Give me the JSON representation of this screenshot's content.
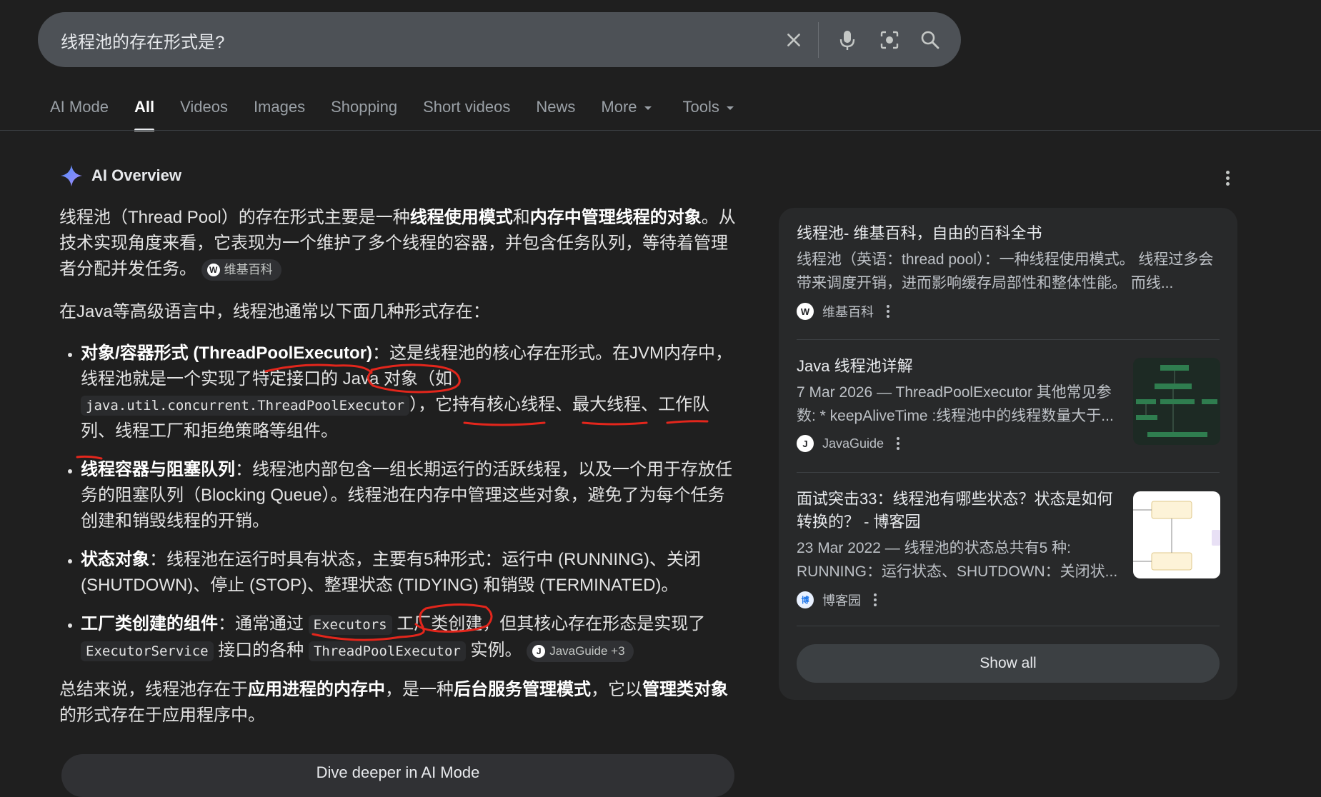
{
  "search": {
    "query": "线程池的存在形式是?"
  },
  "tabs": [
    {
      "label": "AI Mode"
    },
    {
      "label": "All"
    },
    {
      "label": "Videos"
    },
    {
      "label": "Images"
    },
    {
      "label": "Shopping"
    },
    {
      "label": "Short videos"
    },
    {
      "label": "News"
    },
    {
      "label": "More"
    },
    {
      "label": "Tools"
    }
  ],
  "ai_overview": {
    "title": "AI Overview",
    "p1": {
      "t1": "线程池（Thread Pool）的存在形式主要是一种",
      "b1": "线程使用模式",
      "t2": "和",
      "b2": "内存中管理线程的对象",
      "t3": "。从技术实现角度来看，它表现为一个维护了多个线程的容器，并包含任务队列，等待着管理者分配并发任务。",
      "chip": "维基百科"
    },
    "p2": "在Java等高级语言中，线程池通常以下面几种形式存在：",
    "bullets": [
      {
        "bold": "对象/容器形式 (ThreadPoolExecutor)",
        "t1": "：这是线程池的核心存在形式。在JVM内存中，线程池就是一个实现了特定接口的 Java 对象（如 ",
        "code": "java.util.concurrent.ThreadPoolExecutor",
        "t2": "），它持有核心线程、最大线程、工作队列、线程工厂和拒绝策略等组件。"
      },
      {
        "bold": "线程容器与阻塞队列",
        "t1": "：线程池内部包含一组长期运行的活跃线程，以及一个用于存放任务的阻塞队列（Blocking Queue）。线程池在内存中管理这些对象，避免了为每个任务创建和销毁线程的开销。"
      },
      {
        "bold": "状态对象",
        "t1": "：线程池在运行时具有状态，主要有5种形式：运行中 (RUNNING)、关闭 (SHUTDOWN)、停止 (STOP)、整理状态 (TIDYING) 和销毁 (TERMINATED)。"
      },
      {
        "bold": "工厂类创建的组件",
        "t1": "：通常通过 ",
        "code1": "Executors",
        "t2": " 工厂类创建，但其核心存在形态是实现了 ",
        "code2": "ExecutorService",
        "t3": " 接口的各种 ",
        "code3": "ThreadPoolExecutor",
        "t4": " 实例。",
        "chip": "JavaGuide +3"
      }
    ],
    "summary": {
      "t1": "总结来说，线程池存在于",
      "b1": "应用进程的内存中",
      "t2": "，是一种",
      "b2": "后台服务管理模式",
      "t3": "，它以",
      "b3": "管理类对象",
      "t4": "的形式存在于应用程序中。"
    },
    "dive_button": "Dive deeper in AI Mode"
  },
  "sources": [
    {
      "title": "线程池- 维基百科，自由的百科全书",
      "snippet": "线程池（英语：thread pool）：一种线程使用模式。 线程过多会带来调度开销，进而影响缓存局部性和整体性能。 而线...",
      "site": "维基百科",
      "favicon": "W"
    },
    {
      "title": "Java 线程池详解",
      "snippet": "7 Mar 2026 — ThreadPoolExecutor 其他常见参数: * keepAliveTime :线程池中的线程数量大于...",
      "site": "JavaGuide",
      "favicon": "J"
    },
    {
      "title": "面试突击33：线程池有哪些状态？状态是如何转换的？ - 博客园",
      "snippet": "23 Mar 2022 — 线程池的状态总共有5 种: RUNNING：运行状态、SHUTDOWN：关闭状...",
      "site": "博客园",
      "favicon": "博"
    }
  ],
  "show_all": "Show all",
  "colors": {
    "background": "#1f1f1f",
    "search_bar": "#4d5156",
    "panel": "#28292a",
    "annotation": "#e3261c"
  }
}
